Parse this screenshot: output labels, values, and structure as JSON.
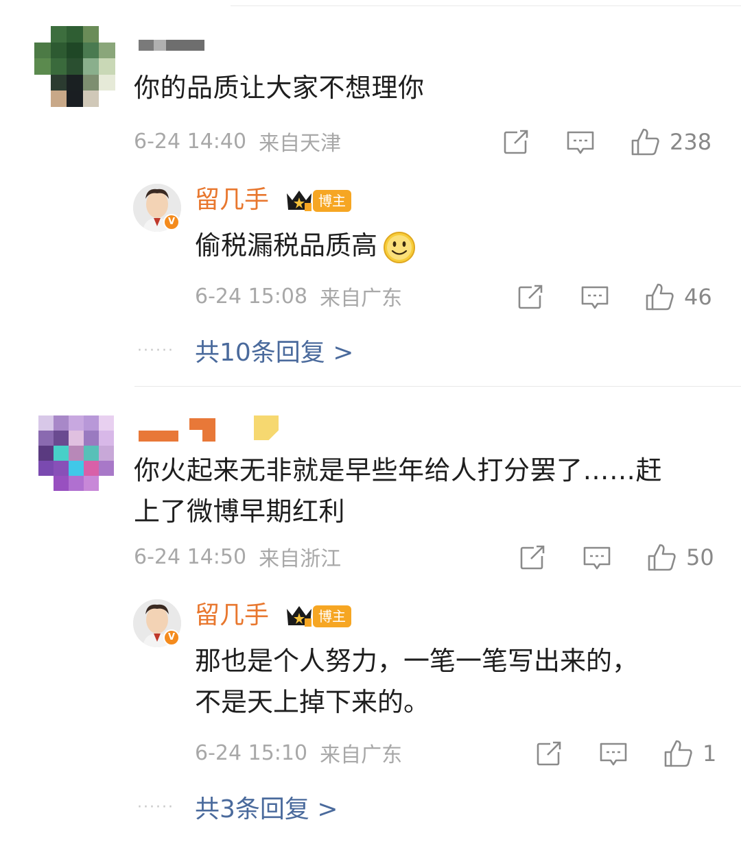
{
  "comments": [
    {
      "text": "你的品质让大家不想理你",
      "time": "6-24 14:40",
      "location": "来自天津",
      "likes": "238",
      "reply": {
        "name": "留几手",
        "badge": "博主",
        "text": "偷税漏税品质高",
        "time": "6-24 15:08",
        "location": "来自广东",
        "likes": "46"
      },
      "more_replies": "共10条回复 >"
    },
    {
      "text_line1": "你火起来无非就是早些年给人打分罢了……赶",
      "text_line2": "上了微博早期红利",
      "time": "6-24 14:50",
      "location": "来自浙江",
      "likes": "50",
      "reply": {
        "name": "留几手",
        "badge": "博主",
        "text_line1": "那也是个人努力，一笔一笔写出来的，",
        "text_line2": "不是天上掉下来的。",
        "time": "6-24 15:10",
        "location": "来自广东",
        "likes": "1"
      },
      "more_replies": "共3条回复 >"
    }
  ],
  "icons": {
    "repost": "repost-icon",
    "comment": "comment-icon",
    "like": "thumbs-up-icon",
    "emoji": "smile-emoji-icon",
    "crown": "crown-icon",
    "verified": "verified-v-icon"
  },
  "colors": {
    "reply_name": "#e8772e",
    "more_link": "#4a6a9c",
    "meta": "#a8a8a8",
    "host_badge": "#f6a623"
  }
}
